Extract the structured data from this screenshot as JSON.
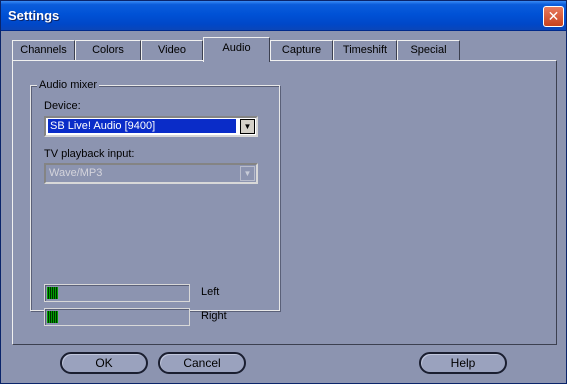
{
  "window": {
    "title": "Settings",
    "close_glyph": "✕"
  },
  "tabs": [
    {
      "label": "Channels",
      "active": false
    },
    {
      "label": "Colors",
      "active": false
    },
    {
      "label": "Video",
      "active": false
    },
    {
      "label": "Audio",
      "active": true
    },
    {
      "label": "Capture",
      "active": false
    },
    {
      "label": "Timeshift",
      "active": false
    },
    {
      "label": "Special",
      "active": false
    }
  ],
  "audio_mixer": {
    "group_label": "Audio mixer",
    "device_label": "Device:",
    "device_value": "SB Live! Audio [9400]",
    "tv_input_label": "TV playback input:",
    "tv_input_value": "Wave/MP3",
    "tv_input_enabled": false,
    "meters": [
      {
        "label": "Left",
        "level": 0.08
      },
      {
        "label": "Right",
        "level": 0.08
      }
    ]
  },
  "buttons": {
    "ok": "OK",
    "cancel": "Cancel",
    "help": "Help"
  },
  "colors": {
    "background": "#8c94b0",
    "titlebar": "#0052d6",
    "selection": "#0a2cc8",
    "meter_green": "#00a000"
  }
}
